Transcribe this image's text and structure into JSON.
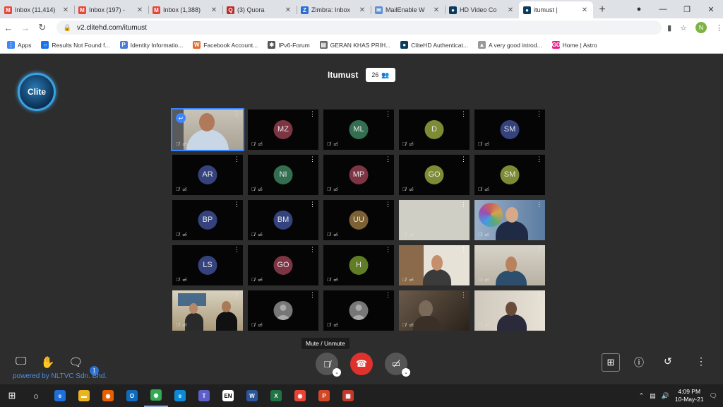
{
  "browser": {
    "tabs": [
      {
        "title": "Inbox (11,414)",
        "icon": "gmail-icon",
        "color": "#ea4335",
        "glyph": "M"
      },
      {
        "title": "Inbox (197) -",
        "icon": "gmail-icon",
        "color": "#ea4335",
        "glyph": "M"
      },
      {
        "title": "Inbox (1,388)",
        "icon": "gmail-icon",
        "color": "#ea4335",
        "glyph": "M"
      },
      {
        "title": "(3) Quora",
        "icon": "quora-icon",
        "color": "#b92b27",
        "glyph": "Q"
      },
      {
        "title": "Zimbra: Inbox",
        "icon": "zimbra-icon",
        "color": "#2a6fd1",
        "glyph": "Z"
      },
      {
        "title": "MailEnable W",
        "icon": "mailenable-icon",
        "color": "#5b8fd6",
        "glyph": "✉"
      },
      {
        "title": "HD Video Co",
        "icon": "clitehd-icon",
        "color": "#0b3c5d",
        "glyph": "●"
      },
      {
        "title": "itumust |",
        "icon": "clitehd-icon",
        "color": "#0b3c5d",
        "glyph": "●",
        "active": true
      }
    ],
    "url": "v2.clitehd.com/itumust",
    "profile_initial": "N",
    "bookmarks": [
      {
        "label": "Apps",
        "icon": "apps-grid-icon",
        "color": "#4285f4",
        "glyph": "⋮"
      },
      {
        "label": "Results Not Found f...",
        "icon": "globe-icon",
        "color": "#1a73e8",
        "glyph": "○"
      },
      {
        "label": "Identity Informatio...",
        "icon": "document-icon",
        "color": "#4b7bd6",
        "glyph": "P"
      },
      {
        "label": "Facebook Account...",
        "icon": "facebook-icon",
        "color": "#e36c2c",
        "glyph": "W"
      },
      {
        "label": "IPv6-Forum",
        "icon": "ipv6-icon",
        "color": "#555555",
        "glyph": "✱"
      },
      {
        "label": "GERAN KHAS PRIH...",
        "icon": "document-icon",
        "color": "#666666",
        "glyph": "▤"
      },
      {
        "label": "CliteHD Authenticat...",
        "icon": "clitehd-icon",
        "color": "#0b3c5d",
        "glyph": "●"
      },
      {
        "label": "A very good introd...",
        "icon": "bookmark-icon",
        "color": "#999999",
        "glyph": "▲"
      },
      {
        "label": "Home | Astro",
        "icon": "astro-icon",
        "color": "#e91e8c",
        "glyph": "GO"
      }
    ]
  },
  "meeting": {
    "logo_text": "Clite",
    "title": "Itumust",
    "participant_count": "26",
    "tiles": [
      {
        "type": "video",
        "pinned": true,
        "scene": "man-office"
      },
      {
        "type": "initials",
        "initials": "MZ",
        "color": "#8b3a4a"
      },
      {
        "type": "initials",
        "initials": "ML",
        "color": "#3a7a5a"
      },
      {
        "type": "initials",
        "initials": "D",
        "color": "#8a9a3a"
      },
      {
        "type": "initials",
        "initials": "SM",
        "color": "#3a4a8a"
      },
      {
        "type": "initials",
        "initials": "AR",
        "color": "#3a4a8a"
      },
      {
        "type": "initials",
        "initials": "NI",
        "color": "#3a7a5a"
      },
      {
        "type": "initials",
        "initials": "MP",
        "color": "#8b3a4a"
      },
      {
        "type": "initials",
        "initials": "GO",
        "color": "#8a9a3a"
      },
      {
        "type": "initials",
        "initials": "SM",
        "color": "#8a9a3a"
      },
      {
        "type": "initials",
        "initials": "BP",
        "color": "#3a4a8a"
      },
      {
        "type": "initials",
        "initials": "BM",
        "color": "#3a4a8a"
      },
      {
        "type": "initials",
        "initials": "UU",
        "color": "#8a6a3a"
      },
      {
        "type": "video",
        "scene": "blank-grey"
      },
      {
        "type": "video",
        "scene": "man-suit-banner"
      },
      {
        "type": "initials",
        "initials": "LS",
        "color": "#3a4a8a"
      },
      {
        "type": "initials",
        "initials": "GO",
        "color": "#8b3a4a"
      },
      {
        "type": "initials",
        "initials": "H",
        "color": "#6a8a2a"
      },
      {
        "type": "video",
        "scene": "man-room"
      },
      {
        "type": "video",
        "scene": "woman-room"
      },
      {
        "type": "video",
        "scene": "two-men-office"
      },
      {
        "type": "avatar"
      },
      {
        "type": "avatar"
      },
      {
        "type": "video",
        "scene": "dark-man"
      },
      {
        "type": "video",
        "scene": "man-suit-room"
      }
    ],
    "tile_status": "🎙̸ ▭̸"
  },
  "controls": {
    "tooltip": "Mute / Unmute",
    "powered_by": "powered by NLTVC Sdn. Bhd.",
    "chat_badge": "1"
  },
  "taskbar": {
    "time": "4:09 PM",
    "date": "10-May-21",
    "apps": [
      {
        "name": "edge-legacy-icon",
        "color": "#1e6fd9",
        "glyph": "e"
      },
      {
        "name": "file-explorer-icon",
        "color": "#e8b420",
        "glyph": "▬"
      },
      {
        "name": "firefox-icon",
        "color": "#e66000",
        "glyph": "◉"
      },
      {
        "name": "outlook-icon",
        "color": "#0f6cbd",
        "glyph": "O"
      },
      {
        "name": "chrome-icon",
        "color": "#34a853",
        "glyph": "◉",
        "active": true
      },
      {
        "name": "edge-icon",
        "color": "#0c8ad6",
        "glyph": "e"
      },
      {
        "name": "teams-icon",
        "color": "#5b5fc7",
        "glyph": "T"
      },
      {
        "name": "language-icon",
        "color": "#ffffff",
        "glyph": "EN"
      },
      {
        "name": "word-icon",
        "color": "#2b579a",
        "glyph": "W"
      },
      {
        "name": "excel-icon",
        "color": "#217346",
        "glyph": "X"
      },
      {
        "name": "chrome-icon-2",
        "color": "#ea4335",
        "glyph": "◉"
      },
      {
        "name": "powerpoint-icon",
        "color": "#d24726",
        "glyph": "P"
      },
      {
        "name": "flag-icon",
        "color": "#c0392b",
        "glyph": "▦"
      }
    ]
  }
}
